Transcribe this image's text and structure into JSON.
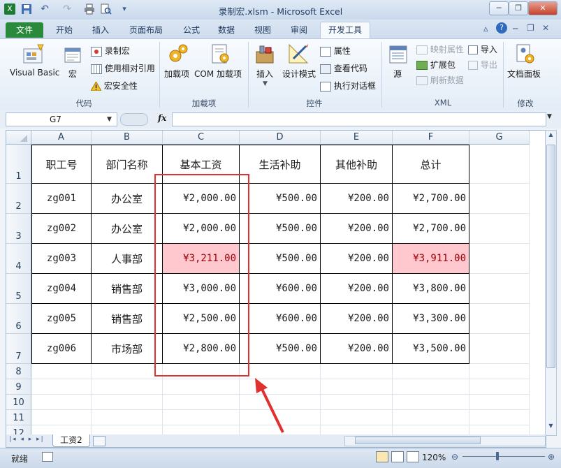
{
  "window": {
    "title": "录制宏.xlsm  -  Microsoft Excel",
    "controls": [
      "─",
      "❐",
      "✕"
    ]
  },
  "tabs": [
    {
      "label": "文件",
      "kind": "file"
    },
    {
      "label": "开始",
      "kind": "normal"
    },
    {
      "label": "插入",
      "kind": "normal"
    },
    {
      "label": "页面布局",
      "kind": "normal"
    },
    {
      "label": "公式",
      "kind": "normal"
    },
    {
      "label": "数据",
      "kind": "normal"
    },
    {
      "label": "视图",
      "kind": "normal"
    },
    {
      "label": "审阅",
      "kind": "normal"
    },
    {
      "label": "开发工具",
      "kind": "active"
    }
  ],
  "ribbon": {
    "code": {
      "label": "代码",
      "visual_basic": "Visual Basic",
      "macros": "宏",
      "record_macro": "录制宏",
      "relative_ref": "使用相对引用",
      "macro_security": "宏安全性"
    },
    "addins": {
      "label": "加载项",
      "addins": "加载项",
      "com_addins": "COM 加载项"
    },
    "controls": {
      "label": "控件",
      "insert": "插入",
      "design_mode": "设计模式",
      "properties": "属性",
      "view_code": "查看代码",
      "run_dialog": "执行对话框"
    },
    "xml": {
      "label": "XML",
      "source": "源",
      "map_properties": "映射属性",
      "expansion_packs": "扩展包",
      "refresh_data": "刷新数据",
      "import": "导入",
      "export": "导出"
    },
    "modify": {
      "label": "修改",
      "document_panel": "文档面板"
    }
  },
  "formula_bar": {
    "name_box": "G7",
    "fx": "fx",
    "value": ""
  },
  "columns": [
    "A",
    "B",
    "C",
    "D",
    "E",
    "F",
    "G"
  ],
  "rows": [
    "1",
    "2",
    "3",
    "4",
    "5",
    "6",
    "7",
    "8",
    "9",
    "10",
    "11",
    "12"
  ],
  "table": {
    "headers": [
      "职工号",
      "部门名称",
      "基本工资",
      "生活补助",
      "其他补助",
      "总计"
    ],
    "records": [
      [
        "zg001",
        "办公室",
        "¥2,000.00",
        "¥500.00",
        "¥200.00",
        "¥2,700.00"
      ],
      [
        "zg002",
        "办公室",
        "¥2,000.00",
        "¥500.00",
        "¥200.00",
        "¥2,700.00"
      ],
      [
        "zg003",
        "人事部",
        "¥3,211.00",
        "¥500.00",
        "¥200.00",
        "¥3,911.00"
      ],
      [
        "zg004",
        "销售部",
        "¥3,000.00",
        "¥600.00",
        "¥200.00",
        "¥3,800.00"
      ],
      [
        "zg005",
        "销售部",
        "¥2,500.00",
        "¥600.00",
        "¥200.00",
        "¥3,300.00"
      ],
      [
        "zg006",
        "市场部",
        "¥2,800.00",
        "¥500.00",
        "¥200.00",
        "¥3,500.00"
      ]
    ],
    "highlight_color": "#ffc7ce",
    "highlight_text_color": "#9c0006"
  },
  "annotation": {
    "box_color": "#e03030"
  },
  "sheets": {
    "active": "工资2"
  },
  "status": {
    "ready": "就绪",
    "zoom": "120%"
  }
}
